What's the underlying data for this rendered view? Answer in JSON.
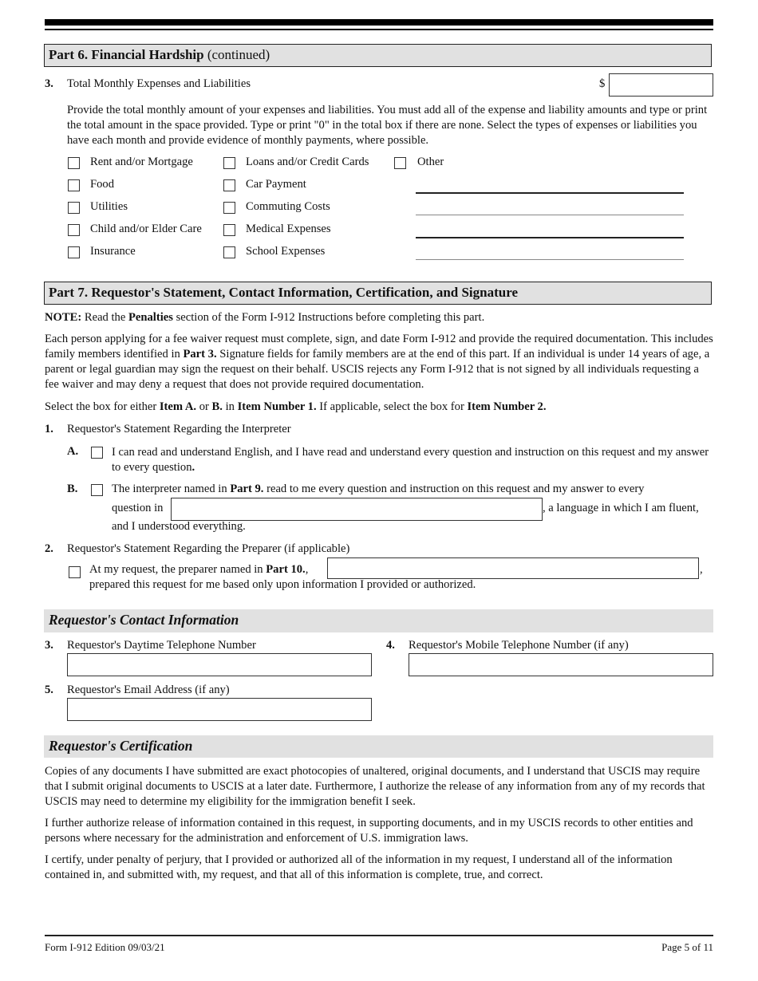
{
  "part6": {
    "header_bold": "Part 6.  Financial Hardship",
    "header_normal": " (continued)",
    "item3": {
      "number": "3.",
      "label": "Total Monthly Expenses and Liabilities",
      "currency": "$",
      "amount_value": "",
      "instructions": "Provide the total monthly amount of your expenses and liabilities.  You must add all of the expense and liability amounts and type or print the total amount in the space provided.  Type or print \"0\" in the total box if there are none.  Select the types of expenses or liabilities you have each month and provide evidence of monthly payments, where possible."
    },
    "expense_checkboxes_col1": [
      {
        "label": "Rent and/or Mortgage",
        "checked": false
      },
      {
        "label": "Food",
        "checked": false
      },
      {
        "label": "Utilities",
        "checked": false
      },
      {
        "label": "Child and/or Elder Care",
        "checked": false
      },
      {
        "label": "Insurance",
        "checked": false
      }
    ],
    "expense_checkboxes_col2": [
      {
        "label": "Loans and/or Credit Cards",
        "checked": false
      },
      {
        "label": "Car Payment",
        "checked": false
      },
      {
        "label": "Commuting Costs",
        "checked": false
      },
      {
        "label": "Medical Expenses",
        "checked": false
      },
      {
        "label": "School Expenses",
        "checked": false
      }
    ],
    "other": {
      "label": "Other",
      "checked": false,
      "lines": [
        "",
        "",
        "",
        ""
      ]
    }
  },
  "part7": {
    "header": "Part 7.  Requestor's Statement, Contact Information, Certification, and Signature",
    "note_label": "NOTE:",
    "note_pre": "  Read the ",
    "note_bold": "Penalties",
    "note_post": " section of the Form I-912 Instructions before completing this part.",
    "intro_1": "Each person applying for a fee waiver request must complete, sign, and date Form I-912 and provide the required documentation. This includes family members identified in ",
    "intro_bold": "Part 3.",
    "intro_2": "  Signature fields for family members are at the end of this part.  If an individual is under 14 years of age, a parent or legal guardian may sign the request on their behalf.  USCIS rejects any Form I-912 that is not signed by all individuals requesting a fee waiver and may deny a request that does not provide required documentation.",
    "select_1": "Select the box for either ",
    "select_b1": "Item A.",
    "select_2": " or ",
    "select_b2": "B.",
    "select_3": " in ",
    "select_b3": "Item Number 1.",
    "select_4": "  If applicable, select the box for ",
    "select_b4": "Item Number 2.",
    "item1": {
      "number": "1.",
      "label": "Requestor's Statement Regarding the Interpreter",
      "a": {
        "letter": "A.",
        "checked": false,
        "text": "I can read and understand English, and I have read and understand every question and instruction on this request and my answer to every question",
        "text_end": "."
      },
      "b": {
        "letter": "B.",
        "checked": false,
        "text_1": "The interpreter named in ",
        "text_bold": "Part 9.",
        "text_2": " read to me every question and instruction on this request and my answer to every",
        "text_3": "question in",
        "language_value": "",
        "text_4": ", a language in which I am fluent,",
        "text_5": "and I understood everything."
      }
    },
    "item2": {
      "number": "2.",
      "label": "Requestor's Statement Regarding the Preparer (if applicable)",
      "checked": false,
      "text_1": "At my request, the preparer named in ",
      "text_bold": "Part 10.",
      "text_2": ",",
      "preparer_value": "",
      "text_comma": ",",
      "text_3": "prepared this request for me based only upon information I provided or authorized."
    },
    "contact": {
      "header": "Requestor's Contact Information",
      "item3": {
        "number": "3.",
        "label": "Requestor's Daytime Telephone Number",
        "value": ""
      },
      "item4": {
        "number": "4.",
        "label": "Requestor's Mobile Telephone Number (if any)",
        "value": ""
      },
      "item5": {
        "number": "5.",
        "label": "Requestor's Email Address (if any)",
        "value": ""
      }
    },
    "certification": {
      "header": "Requestor's Certification",
      "para1": "Copies of any documents I have submitted are exact photocopies of unaltered, original documents, and I understand that USCIS may require that I submit original documents to USCIS at a later date.  Furthermore, I authorize the release of any information from any of my records that USCIS may need to determine my eligibility for the immigration benefit I seek.",
      "para2": "I further authorize release of information contained in this request, in supporting documents, and in my USCIS records to other entities and persons where necessary for the administration and enforcement of U.S. immigration laws.",
      "para3": "I certify, under penalty of perjury, that I provided or authorized all of the information in my request, I understand all of the information contained in, and submitted with, my request, and that all of this information is complete, true, and correct."
    }
  },
  "footer": {
    "form_edition": "Form I-912   Edition   09/03/21",
    "page": "Page 5 of 11"
  }
}
